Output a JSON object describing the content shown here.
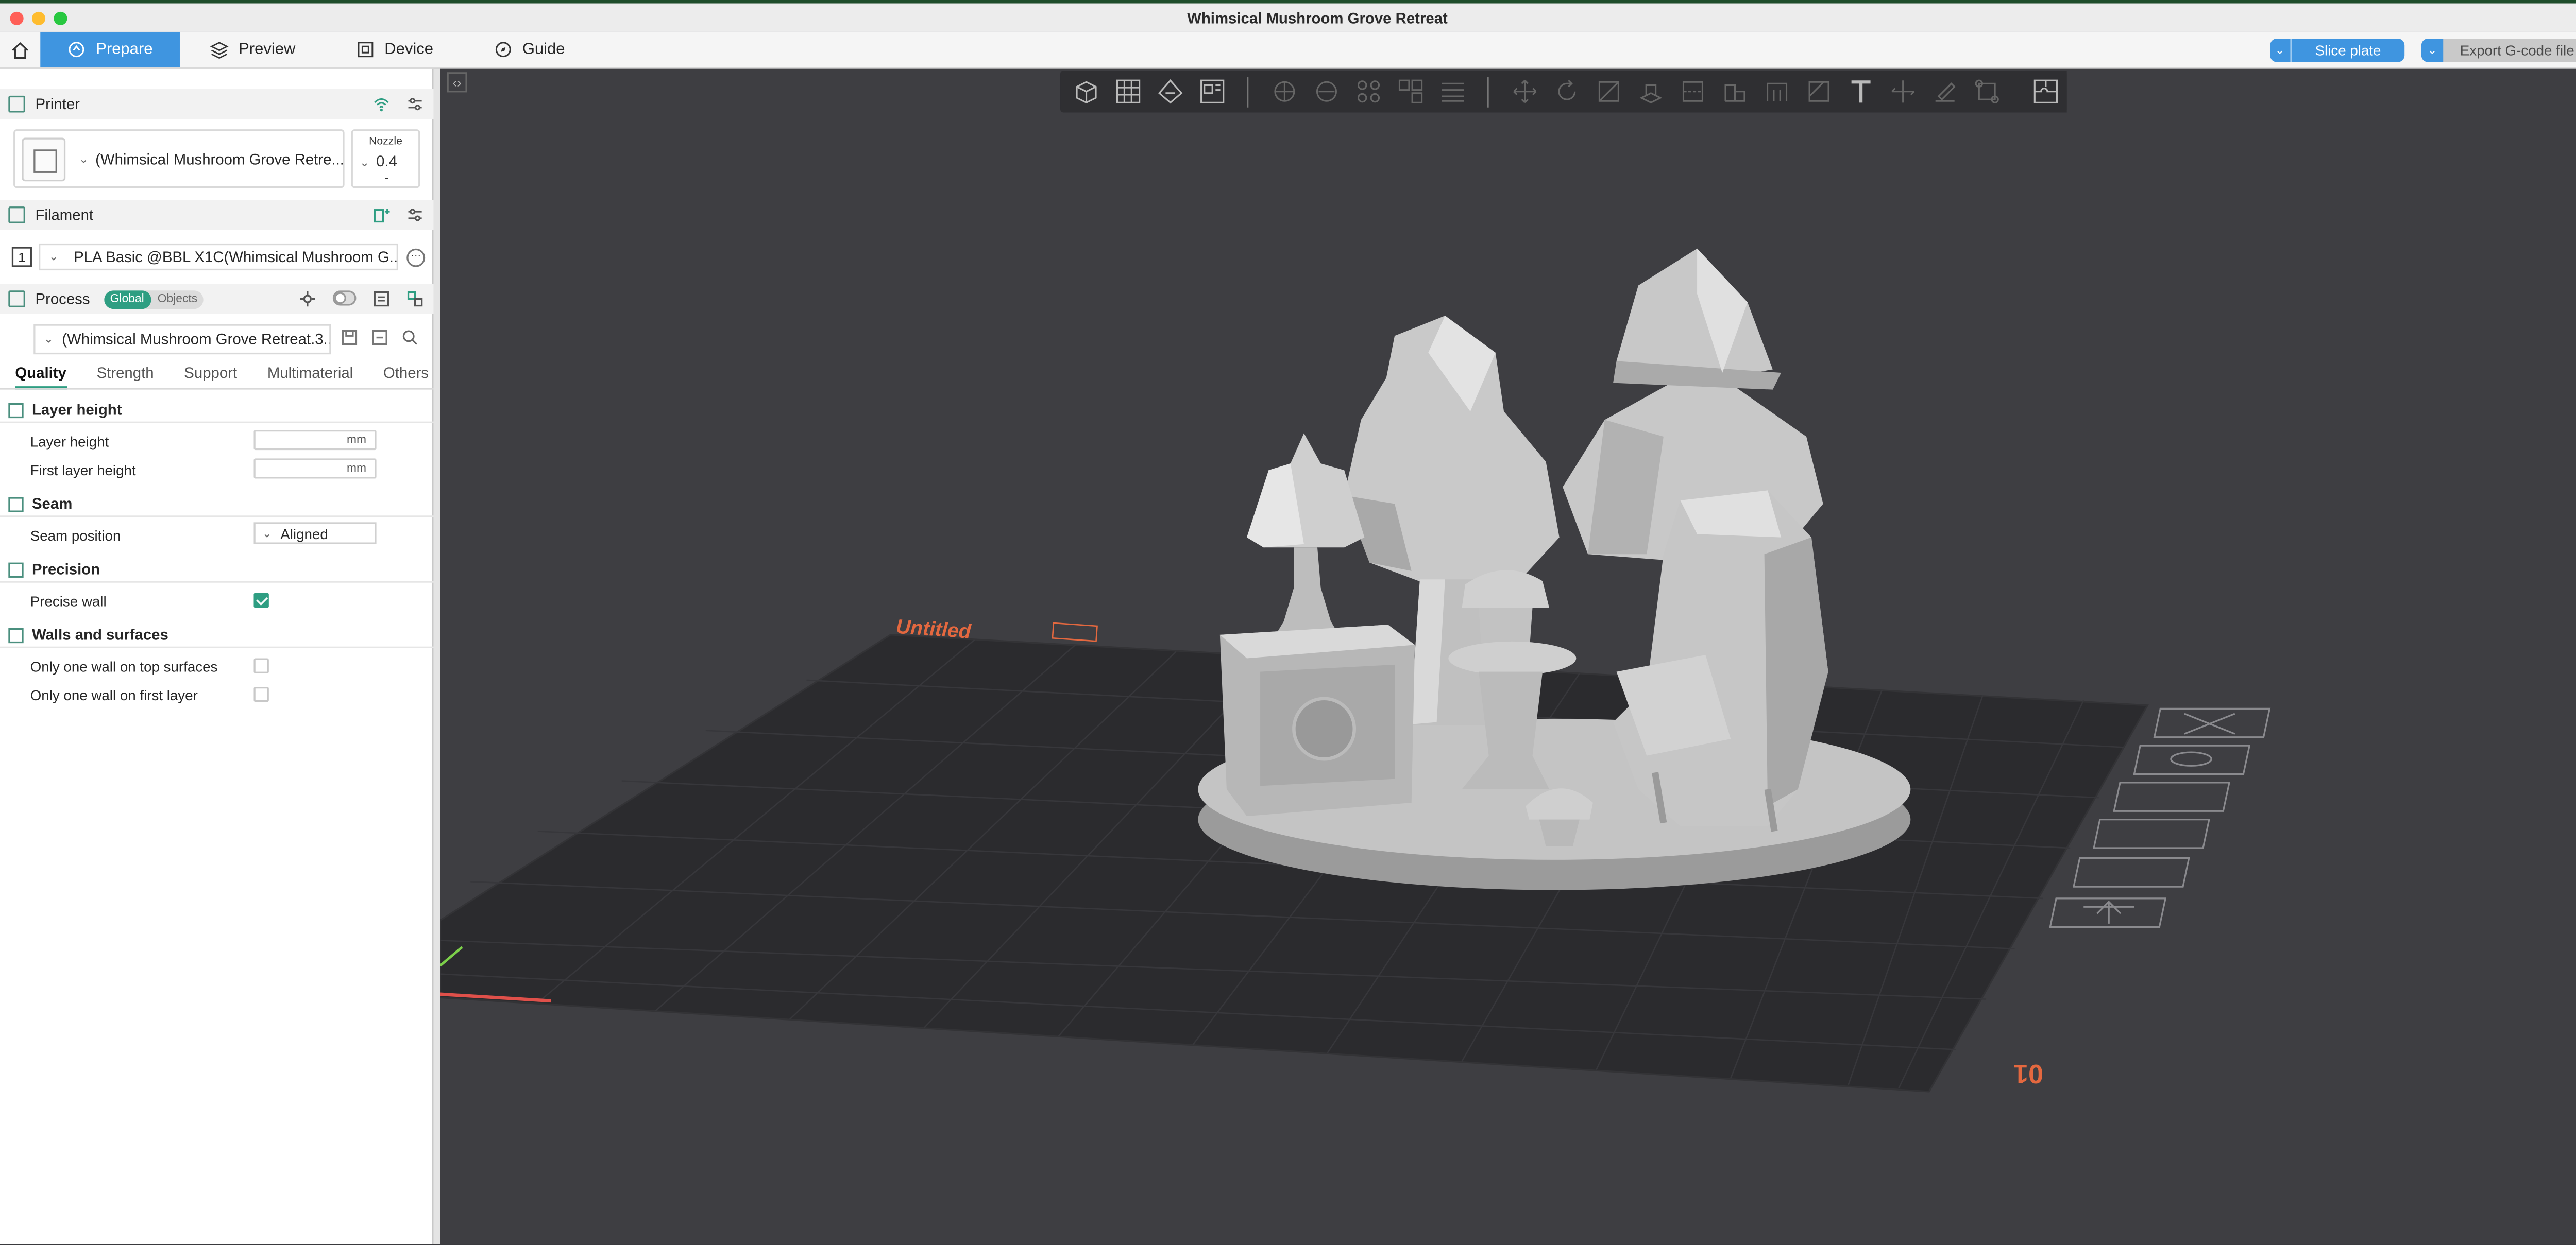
{
  "window": {
    "title": "Whimsical Mushroom Grove Retreat"
  },
  "tabs": [
    {
      "label": "Prepare",
      "icon": "prepare-icon",
      "active": true
    },
    {
      "label": "Preview",
      "icon": "layers-icon"
    },
    {
      "label": "Device",
      "icon": "device-icon"
    },
    {
      "label": "Guide",
      "icon": "compass-icon"
    }
  ],
  "actions": {
    "slice": "Slice plate",
    "export": "Export G-code file"
  },
  "printer": {
    "header": "Printer",
    "name": "(Whimsical Mushroom Grove Retre...",
    "nozzle_label": "Nozzle",
    "nozzle_value": "0.4",
    "nozzle_dash": "-"
  },
  "filament": {
    "header": "Filament",
    "index": "1",
    "name": "PLA Basic @BBL X1C(Whimsical Mushroom G..."
  },
  "process": {
    "header": "Process",
    "toggle_global": "Global",
    "toggle_objects": "Objects",
    "preset": "(Whimsical Mushroom Grove Retreat.3..."
  },
  "subtabs": [
    "Quality",
    "Strength",
    "Support",
    "Multimaterial",
    "Others"
  ],
  "groups": {
    "layer_height": {
      "title": "Layer height",
      "layer_height_label": "Layer height",
      "layer_height_unit": "mm",
      "first_layer_label": "First layer height",
      "first_layer_unit": "mm"
    },
    "seam": {
      "title": "Seam",
      "seam_position_label": "Seam position",
      "seam_position_value": "Aligned"
    },
    "precision": {
      "title": "Precision",
      "precise_wall_label": "Precise wall",
      "precise_wall_checked": true
    },
    "walls": {
      "title": "Walls and surfaces",
      "top_one_wall_label": "Only one wall on top surfaces",
      "first_layer_one_wall_label": "Only one wall on first layer"
    }
  },
  "plate": {
    "name": "Untitled",
    "number": "01"
  },
  "colors": {
    "accent_blue": "#3f95e0",
    "accent_green": "#2e9e82",
    "viewport_bg": "#3e3e42",
    "plate_bg": "#2b2b2e",
    "plate_label": "#e4683f"
  }
}
